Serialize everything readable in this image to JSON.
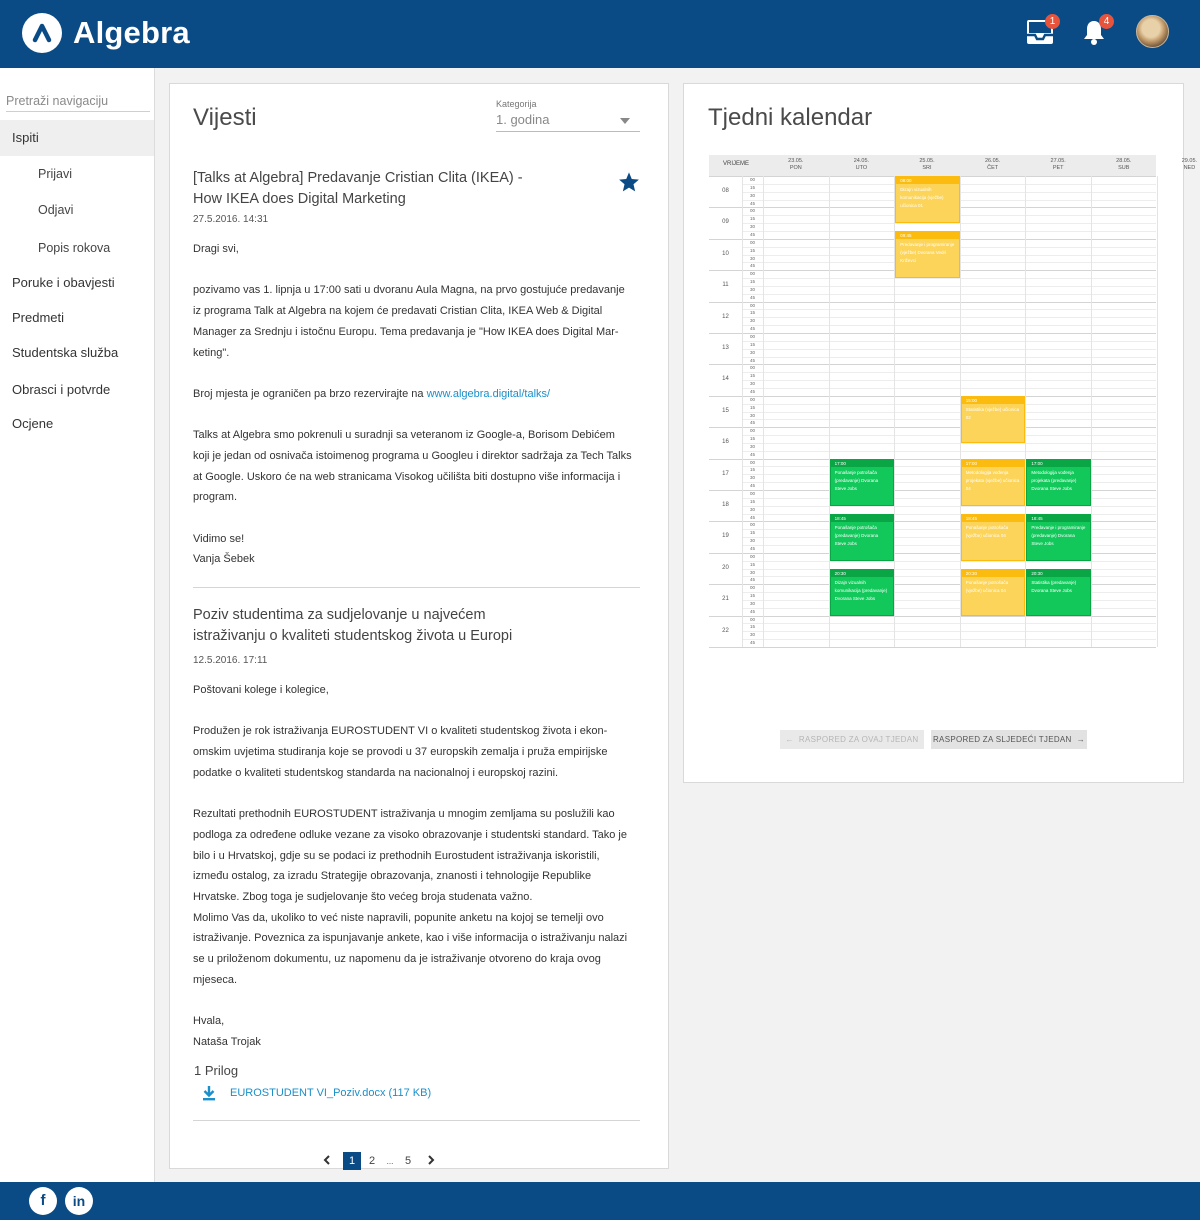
{
  "header": {
    "brand": "Algebra",
    "inbox_badge": "1",
    "notif_badge": "4",
    "colors": {
      "bar": "#0b4b85",
      "badge": "#e8533b"
    }
  },
  "sidebar": {
    "search_placeholder": "Pretraži navigaciju",
    "items": [
      {
        "label": "Ispiti",
        "active": true
      },
      {
        "label": "Prijavi"
      },
      {
        "label": "Odjavi"
      },
      {
        "label": "Popis rokova"
      },
      {
        "label": "Poruke i obavjesti"
      },
      {
        "label": "Predmeti"
      },
      {
        "label": "Studentska služba"
      },
      {
        "label": "Obrasci i potvrde"
      },
      {
        "label": "Ocjene"
      }
    ]
  },
  "news": {
    "title": "Vijesti",
    "category_label": "Kategorija",
    "category_value": "1. godina",
    "items": [
      {
        "title": "[Talks at Algebra] Predavanje Cristian Clita (IKEA) -\nHow IKEA does Digital Marketing",
        "date": "27.5.2016. 14:31",
        "greeting": "Dragi svi,",
        "p1": "pozivamo vas 1. lipnja u 17:00 sati u dvoranu Aula Magna, na prvo gostujuće predavanje\niz programa Talk at Algebra na kojem će predavati Cristian Clita, IKEA Web & Digital\nManager za Srednju i istočnu Europu. Tema predavanja je \"How IKEA does  Digital Mar-\nketing\".",
        "p2_pre": "Broj mjesta je ograničen pa brzo rezervirajte na ",
        "p2_link": "www.algebra.digital/talks/",
        "p3": "Talks at Algebra smo pokrenuli u suradnji sa veteranom iz Google-a, Borisom Debićem\nkoji je jedan od osnivača istoimenog programa u Googleu i direktor sadržaja za Tech Talks\nat Google. Uskoro će na web stranicama Visokog učilišta biti dostupno više informacija i\nprogram.",
        "closing": "Vidimo se!",
        "signature": "Vanja Šebek"
      },
      {
        "title": "Poziv studentima za sudjelovanje u najvećem\nistraživanju o kvaliteti studentskog života u Europi",
        "date": "12.5.2016. 17:11",
        "greeting": "Poštovani kolege i kolegice,",
        "p1": "Produžen je rok istraživanja EUROSTUDENT VI o kvaliteti studentskog života i ekon-\nomskim uvjetima studiranja koje se provodi u 37 europskih zemalja i pruža empirijske\npodatke o kvaliteti studentskog standarda na nacionalnoj i europskoj razini.",
        "p2": "Rezultati prethodnih EUROSTUDENT istraživanja u mnogim zemljama su poslužili kao\npodloga za određene odluke vezane za visoko obrazovanje i studentski standard. Tako je\nbilo i u Hrvatskoj, gdje su se podaci iz prethodnih Eurostudent istraživanja iskoristili,\nizmeđu ostalog, za izradu Strategije obrazovanja, znanosti i tehnologije Republike\nHrvatske. Zbog toga je sudjelovanje što većeg broja studenata važno.\nMolimo Vas da, ukoliko to već niste napravili, popunite anketu na kojoj se temelji ovo\nistraživanje. Poveznica za ispunjavanje ankete, kao i više informacija o istraživanju nalazi\nse u priloženom dokumentu, uz napomenu da je istraživanje otvoreno do kraja ovog\nmjeseca.",
        "closing": "Hvala,",
        "signature": "Nataša Trojak",
        "attachments_header": "1 Prilog",
        "attachment": "EUROSTUDENT VI_Poziv.docx (117 KB)"
      }
    ],
    "pagination": {
      "current": "1",
      "p2": "2",
      "dots": "...",
      "last": "5"
    }
  },
  "calendar": {
    "title": "Tjedni kalendar",
    "time_header": "VRIJEME",
    "days": [
      {
        "date": "23.05.",
        "name": "PON"
      },
      {
        "date": "24.05.",
        "name": "UTO"
      },
      {
        "date": "25.05.",
        "name": "SRI"
      },
      {
        "date": "26.05.",
        "name": "ČET"
      },
      {
        "date": "27.05.",
        "name": "PET"
      },
      {
        "date": "28.05.",
        "name": "SUB"
      },
      {
        "date": "29.05.",
        "name": "NED"
      }
    ],
    "hours": [
      "08",
      "09",
      "10",
      "11",
      "12",
      "13",
      "14",
      "15",
      "16",
      "17",
      "18",
      "19",
      "20",
      "21",
      "22"
    ],
    "minutes": [
      "00",
      "15",
      "30",
      "45"
    ],
    "events": [
      {
        "day": 2,
        "start": 8.0,
        "end": 9.5,
        "color": "yellow",
        "time": "08:00",
        "title": "Dizajn vizualnih komunikacija (vježbe) učionica 01"
      },
      {
        "day": 2,
        "start": 9.75,
        "end": 11.25,
        "color": "yellow",
        "time": "09:45",
        "title": "Predavanje i programiranje (vježbe) Dvorana Vedri Križevci"
      },
      {
        "day": 3,
        "start": 15.0,
        "end": 16.5,
        "color": "yellow",
        "time": "15:00",
        "title": "Statistika (vježbe) učionica 02"
      },
      {
        "day": 1,
        "start": 17.0,
        "end": 18.5,
        "color": "green",
        "time": "17:00",
        "title": "Ponašanje potrošača (predavanje) Dvorana Steve Jobs"
      },
      {
        "day": 3,
        "start": 17.0,
        "end": 18.5,
        "color": "yellow",
        "time": "17:00",
        "title": "Metodologija vođenja projekata (vježbe) učionica 04"
      },
      {
        "day": 4,
        "start": 17.0,
        "end": 18.5,
        "color": "green",
        "time": "17:00",
        "title": "Metodologija vođenja projekata (predavanje) Dvorana Steve Jobs"
      },
      {
        "day": 1,
        "start": 18.75,
        "end": 20.25,
        "color": "green",
        "time": "18:45",
        "title": "Ponašanje potrošača (predavanje) Dvorana Steve Jobs"
      },
      {
        "day": 3,
        "start": 18.75,
        "end": 20.25,
        "color": "yellow",
        "time": "18:45",
        "title": "Ponašanje potrošača (vježbe) učionica 04"
      },
      {
        "day": 4,
        "start": 18.75,
        "end": 20.25,
        "color": "green",
        "time": "18:45",
        "title": "Predavanje i programiranje (predavanje) Dvorana Steve Jobs"
      },
      {
        "day": 1,
        "start": 20.5,
        "end": 22.0,
        "color": "green",
        "time": "20:30",
        "title": "Dizajn vizualnih komunikacija (predavanje) Dvorana Steve Jobs"
      },
      {
        "day": 3,
        "start": 20.5,
        "end": 22.0,
        "color": "yellow",
        "time": "20:30",
        "title": "Ponašanje potrošača (vježbe) učionica 04"
      },
      {
        "day": 4,
        "start": 20.5,
        "end": 22.0,
        "color": "green",
        "time": "20:30",
        "title": "Statistika (predavanje) Dvorana Steve Jobs"
      }
    ],
    "btn_prev": "RASPORED ZA OVAJ TJEDAN",
    "btn_next": "RASPORED ZA SLJEDEĆI TJEDAN"
  },
  "footer": {
    "facebook": "f",
    "linkedin": "in"
  }
}
